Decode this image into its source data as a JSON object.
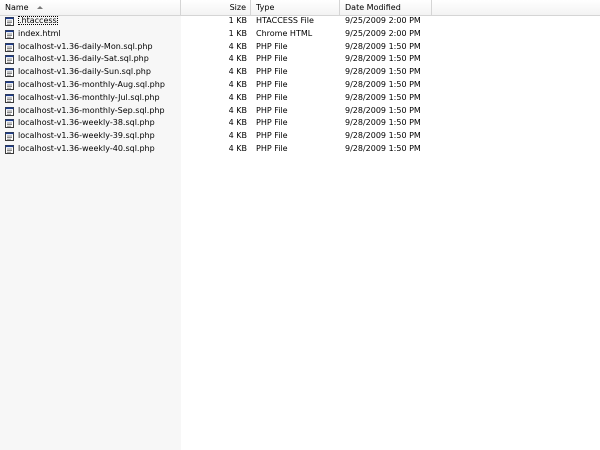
{
  "columns": {
    "name": "Name",
    "size": "Size",
    "type": "Type",
    "date": "Date Modified"
  },
  "files": [
    {
      "name": ".htaccess",
      "size": "1 KB",
      "type": "HTACCESS File",
      "date": "9/25/2009 2:00 PM",
      "icon": "document-icon"
    },
    {
      "name": "index.html",
      "size": "1 KB",
      "type": "Chrome HTML",
      "date": "9/25/2009 2:00 PM",
      "icon": "html-document-icon"
    },
    {
      "name": "localhost-v1.36-daily-Mon.sql.php",
      "size": "4 KB",
      "type": "PHP File",
      "date": "9/28/2009 1:50 PM",
      "icon": "document-icon"
    },
    {
      "name": "localhost-v1.36-daily-Sat.sql.php",
      "size": "4 KB",
      "type": "PHP File",
      "date": "9/28/2009 1:50 PM",
      "icon": "document-icon"
    },
    {
      "name": "localhost-v1.36-daily-Sun.sql.php",
      "size": "4 KB",
      "type": "PHP File",
      "date": "9/28/2009 1:50 PM",
      "icon": "document-icon"
    },
    {
      "name": "localhost-v1.36-monthly-Aug.sql.php",
      "size": "4 KB",
      "type": "PHP File",
      "date": "9/28/2009 1:50 PM",
      "icon": "document-icon"
    },
    {
      "name": "localhost-v1.36-monthly-Jul.sql.php",
      "size": "4 KB",
      "type": "PHP File",
      "date": "9/28/2009 1:50 PM",
      "icon": "document-icon"
    },
    {
      "name": "localhost-v1.36-monthly-Sep.sql.php",
      "size": "4 KB",
      "type": "PHP File",
      "date": "9/28/2009 1:50 PM",
      "icon": "document-icon"
    },
    {
      "name": "localhost-v1.36-weekly-38.sql.php",
      "size": "4 KB",
      "type": "PHP File",
      "date": "9/28/2009 1:50 PM",
      "icon": "document-icon"
    },
    {
      "name": "localhost-v1.36-weekly-39.sql.php",
      "size": "4 KB",
      "type": "PHP File",
      "date": "9/28/2009 1:50 PM",
      "icon": "document-icon"
    },
    {
      "name": "localhost-v1.36-weekly-40.sql.php",
      "size": "4 KB",
      "type": "PHP File",
      "date": "9/28/2009 1:50 PM",
      "icon": "document-icon"
    }
  ]
}
